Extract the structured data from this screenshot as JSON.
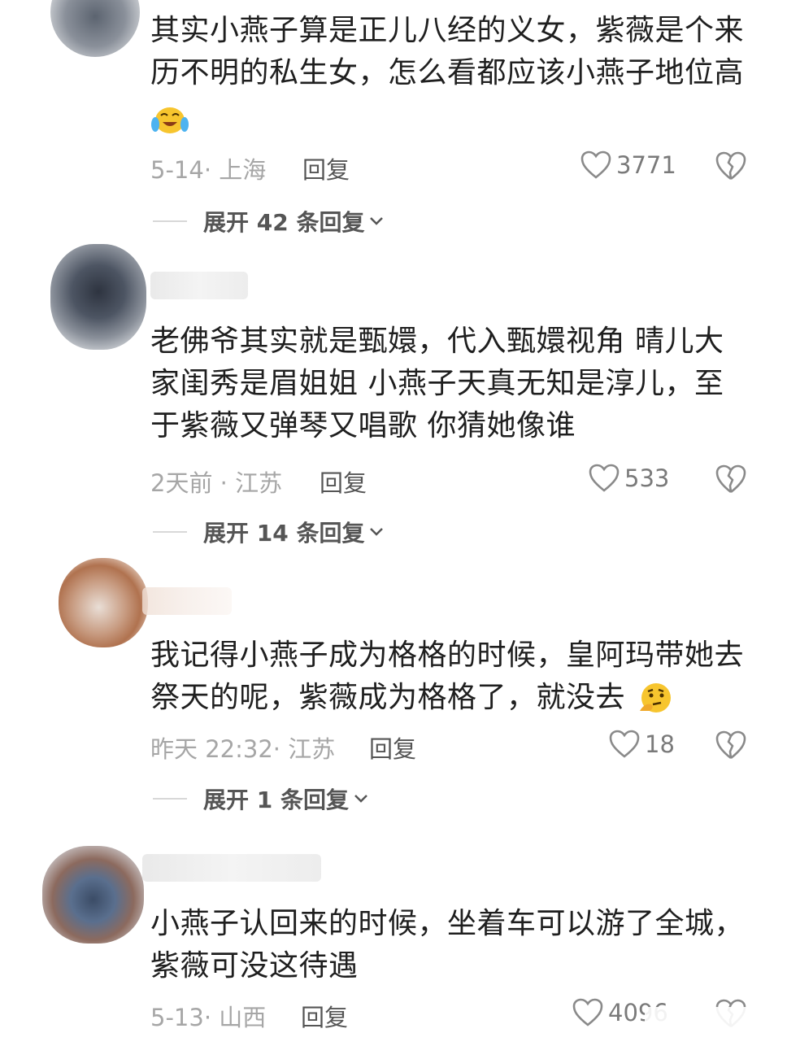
{
  "comments": [
    {
      "text": "其实小燕子算是正儿八经的义女，紫薇是个来历不明的私生女，怎么看都应该小燕子地位高",
      "emoji": "laugh-cry-emoji",
      "meta": "5-14· 上海",
      "reply": "回复",
      "likes": "3771",
      "expand": "展开 42 条回复"
    },
    {
      "text": "老佛爷其实就是甄嬛，代入甄嬛视角 晴儿大家闺秀是眉姐姐 小燕子天真无知是淳儿，至于紫薇又弹琴又唱歌 你猜她像谁",
      "meta": "2天前 · 江苏",
      "reply": "回复",
      "likes": "533",
      "expand": "展开 14 条回复"
    },
    {
      "text": "我记得小燕子成为格格的时候，皇阿玛带她去祭天的呢，紫薇成为格格了，就没去",
      "emoji": "thinking-emoji",
      "meta": "昨天 22:32· 江苏",
      "reply": "回复",
      "likes": "18",
      "expand": "展开 1 条回复"
    },
    {
      "text": "小燕子认回来的时候，坐着车可以游了全城，紫薇可没这待遇",
      "meta": "5-13· 山西",
      "reply": "回复",
      "likes": "4096"
    }
  ],
  "colors": {
    "text": "#1f1f1f",
    "meta": "#a6a6a6",
    "emoji_yellow": "#f7c52e"
  }
}
